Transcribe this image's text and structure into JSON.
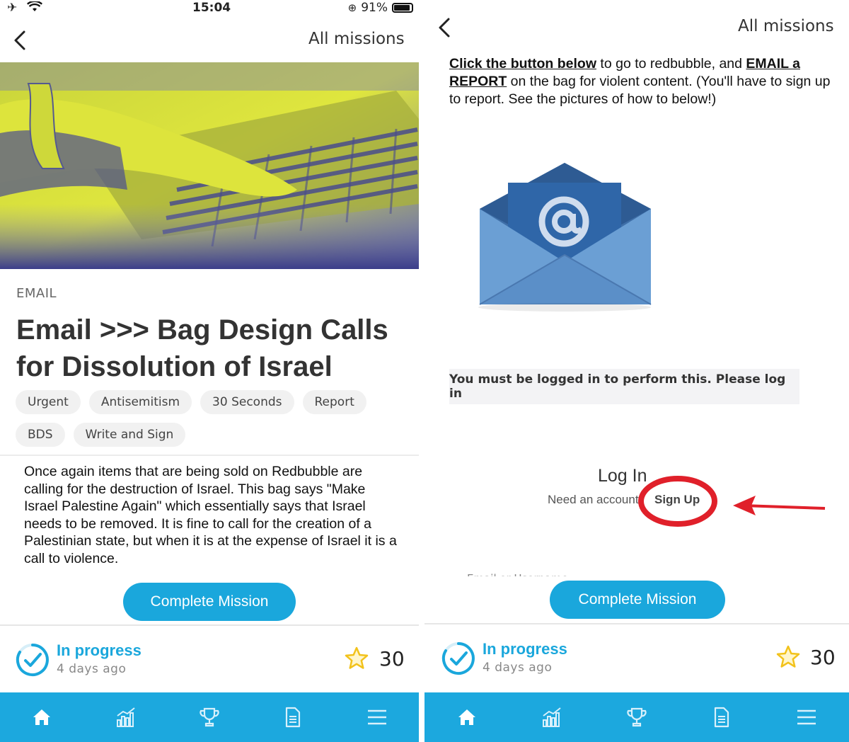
{
  "left": {
    "status": {
      "time": "15:04",
      "battery": "91%"
    },
    "nav": {
      "link": "All missions"
    },
    "category": "EMAIL",
    "title": "Email >>> Bag Design Calls for Dissolution of Israel",
    "tags": [
      "Urgent",
      "Antisemitism",
      "30 Seconds",
      "Report",
      "BDS",
      "Write and Sign"
    ],
    "description": "Once again items that are being sold on Redbubble are calling for the destruction of Israel. This bag says \"Make Israel Palestine Again\" which essentially says that Israel needs to be removed. It is fine to call for the creation of a Palestinian state, but when it is at the expense of Israel it is a call to violence.",
    "cta": "Complete Mission",
    "progress": {
      "status": "In progress",
      "when": "4 days ago",
      "points": "30"
    }
  },
  "right": {
    "nav": {
      "link": "All missions"
    },
    "instructions": {
      "link1": "Click the button below",
      "text1": " to go to redbubble, and ",
      "link2": "EMAIL a REPORT",
      "text2": " on the bag for violent content. (You'll have to sign up to report. See the pictures of how to below!)"
    },
    "login_banner": "You must be logged in to perform this. Please log in",
    "login_title": "Log In",
    "need_account": "Need an account",
    "signup": "Sign Up",
    "cut_field_label": "Email or Username",
    "cta": "Complete Mission",
    "progress": {
      "status": "In progress",
      "when": "4 days ago",
      "points": "30"
    }
  },
  "icons": {
    "tabbar": [
      "home-icon",
      "stats-icon",
      "trophy-icon",
      "document-icon",
      "menu-icon"
    ],
    "status_left": [
      "airplane-icon",
      "wifi-icon"
    ]
  },
  "colors": {
    "accent": "#1aa7dc",
    "tabbar": "#1ca8de",
    "annotation": "#e0202a",
    "hero_tint": "#d8e23a",
    "hero_shadow": "#3c3e8c"
  }
}
